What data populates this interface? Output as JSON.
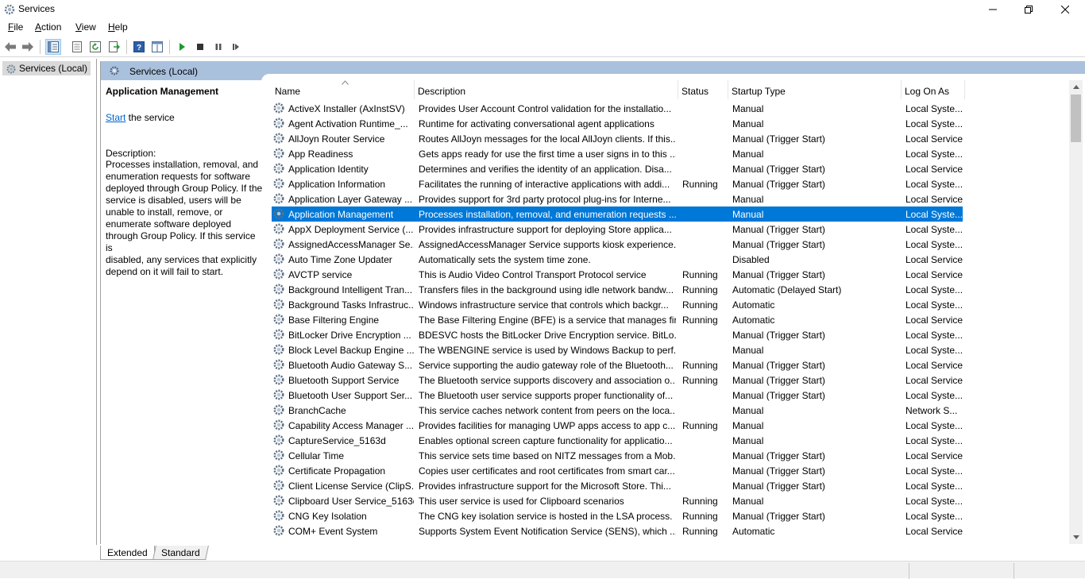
{
  "window": {
    "title": "Services",
    "icon": "services-gear-icon",
    "controls": {
      "minimize": "—",
      "restore": "❐",
      "close": "✕"
    }
  },
  "menu": {
    "items": [
      {
        "label": "File",
        "accel": "F"
      },
      {
        "label": "Action",
        "accel": "A"
      },
      {
        "label": "View",
        "accel": "V"
      },
      {
        "label": "Help",
        "accel": "H"
      }
    ]
  },
  "toolbar": {
    "buttons": [
      "back-arrow-icon",
      "forward-arrow-icon",
      "show-hide-console-tree-icon",
      "properties-icon",
      "refresh-icon",
      "export-list-icon",
      "help-icon",
      "show-hide-action-pane-icon",
      "start-service-icon",
      "stop-service-icon",
      "pause-service-icon",
      "restart-service-icon"
    ]
  },
  "tree": {
    "root_label": "Services (Local)"
  },
  "pane": {
    "header_label": "Services (Local)",
    "selected_service": "Application Management",
    "action_link": "Start",
    "action_suffix": " the service",
    "description_label": "Description:",
    "description_lines": [
      "Processes installation, removal, and",
      "enumeration requests for software",
      "deployed through Group Policy. If the",
      "service is disabled, users will be",
      "unable to install, remove, or",
      "enumerate software deployed",
      "through Group Policy. If this service is",
      "disabled, any services that explicitly",
      "depend on it will fail to start."
    ]
  },
  "grid": {
    "columns": [
      "Name",
      "Description",
      "Status",
      "Startup Type",
      "Log On As"
    ],
    "selected_row": 7,
    "rows": [
      {
        "name": "ActiveX Installer (AxInstSV)",
        "description": "Provides User Account Control validation for the installatio...",
        "status": "",
        "startup": "Manual",
        "logon": "Local Syste..."
      },
      {
        "name": "Agent Activation Runtime_...",
        "description": "Runtime for activating conversational agent applications",
        "status": "",
        "startup": "Manual",
        "logon": "Local Syste..."
      },
      {
        "name": "AllJoyn Router Service",
        "description": "Routes AllJoyn messages for the local AllJoyn clients. If this...",
        "status": "",
        "startup": "Manual (Trigger Start)",
        "logon": "Local Service"
      },
      {
        "name": "App Readiness",
        "description": "Gets apps ready for use the first time a user signs in to this ...",
        "status": "",
        "startup": "Manual",
        "logon": "Local Syste..."
      },
      {
        "name": "Application Identity",
        "description": "Determines and verifies the identity of an application. Disa...",
        "status": "",
        "startup": "Manual (Trigger Start)",
        "logon": "Local Service"
      },
      {
        "name": "Application Information",
        "description": "Facilitates the running of interactive applications with addi...",
        "status": "Running",
        "startup": "Manual (Trigger Start)",
        "logon": "Local Syste..."
      },
      {
        "name": "Application Layer Gateway ...",
        "description": "Provides support for 3rd party protocol plug-ins for Interne...",
        "status": "",
        "startup": "Manual",
        "logon": "Local Service"
      },
      {
        "name": "Application Management",
        "description": "Processes installation, removal, and enumeration requests ...",
        "status": "",
        "startup": "Manual",
        "logon": "Local Syste..."
      },
      {
        "name": "AppX Deployment Service (...",
        "description": "Provides infrastructure support for deploying Store applica...",
        "status": "",
        "startup": "Manual (Trigger Start)",
        "logon": "Local Syste..."
      },
      {
        "name": "AssignedAccessManager Se...",
        "description": "AssignedAccessManager Service supports kiosk experience...",
        "status": "",
        "startup": "Manual (Trigger Start)",
        "logon": "Local Syste..."
      },
      {
        "name": "Auto Time Zone Updater",
        "description": "Automatically sets the system time zone.",
        "status": "",
        "startup": "Disabled",
        "logon": "Local Service"
      },
      {
        "name": "AVCTP service",
        "description": "This is Audio Video Control Transport Protocol service",
        "status": "Running",
        "startup": "Manual (Trigger Start)",
        "logon": "Local Service"
      },
      {
        "name": "Background Intelligent Tran...",
        "description": "Transfers files in the background using idle network bandw...",
        "status": "Running",
        "startup": "Automatic (Delayed Start)",
        "logon": "Local Syste..."
      },
      {
        "name": "Background Tasks Infrastruc...",
        "description": "Windows infrastructure service that controls which backgr...",
        "status": "Running",
        "startup": "Automatic",
        "logon": "Local Syste..."
      },
      {
        "name": "Base Filtering Engine",
        "description": "The Base Filtering Engine (BFE) is a service that manages fir...",
        "status": "Running",
        "startup": "Automatic",
        "logon": "Local Service"
      },
      {
        "name": "BitLocker Drive Encryption ...",
        "description": "BDESVC hosts the BitLocker Drive Encryption service. BitLo...",
        "status": "",
        "startup": "Manual (Trigger Start)",
        "logon": "Local Syste..."
      },
      {
        "name": "Block Level Backup Engine ...",
        "description": "The WBENGINE service is used by Windows Backup to perf...",
        "status": "",
        "startup": "Manual",
        "logon": "Local Syste..."
      },
      {
        "name": "Bluetooth Audio Gateway S...",
        "description": "Service supporting the audio gateway role of the Bluetooth...",
        "status": "Running",
        "startup": "Manual (Trigger Start)",
        "logon": "Local Service"
      },
      {
        "name": "Bluetooth Support Service",
        "description": "The Bluetooth service supports discovery and association o...",
        "status": "Running",
        "startup": "Manual (Trigger Start)",
        "logon": "Local Service"
      },
      {
        "name": "Bluetooth User Support Ser...",
        "description": "The Bluetooth user service supports proper functionality of...",
        "status": "",
        "startup": "Manual (Trigger Start)",
        "logon": "Local Syste..."
      },
      {
        "name": "BranchCache",
        "description": "This service caches network content from peers on the loca...",
        "status": "",
        "startup": "Manual",
        "logon": "Network S..."
      },
      {
        "name": "Capability Access Manager ...",
        "description": "Provides facilities for managing UWP apps access to app c...",
        "status": "Running",
        "startup": "Manual",
        "logon": "Local Syste..."
      },
      {
        "name": "CaptureService_5163d",
        "description": "Enables optional screen capture functionality for applicatio...",
        "status": "",
        "startup": "Manual",
        "logon": "Local Syste..."
      },
      {
        "name": "Cellular Time",
        "description": "This service sets time based on NITZ messages from a Mob...",
        "status": "",
        "startup": "Manual (Trigger Start)",
        "logon": "Local Service"
      },
      {
        "name": "Certificate Propagation",
        "description": "Copies user certificates and root certificates from smart car...",
        "status": "",
        "startup": "Manual (Trigger Start)",
        "logon": "Local Syste..."
      },
      {
        "name": "Client License Service (ClipS...",
        "description": "Provides infrastructure support for the Microsoft Store. Thi...",
        "status": "",
        "startup": "Manual (Trigger Start)",
        "logon": "Local Syste..."
      },
      {
        "name": "Clipboard User Service_5163d",
        "description": "This user service is used for Clipboard scenarios",
        "status": "Running",
        "startup": "Manual",
        "logon": "Local Syste..."
      },
      {
        "name": "CNG Key Isolation",
        "description": "The CNG key isolation service is hosted in the LSA process. ...",
        "status": "Running",
        "startup": "Manual (Trigger Start)",
        "logon": "Local Syste..."
      },
      {
        "name": "COM+ Event System",
        "description": "Supports System Event Notification Service (SENS), which ...",
        "status": "Running",
        "startup": "Automatic",
        "logon": "Local Service"
      }
    ]
  },
  "tabs": [
    {
      "label": "Extended",
      "active": true
    },
    {
      "label": "Standard",
      "active": false
    }
  ],
  "colors": {
    "selection": "#0078d7",
    "pane_header": "#a9c1dd",
    "link": "#0066cc"
  }
}
